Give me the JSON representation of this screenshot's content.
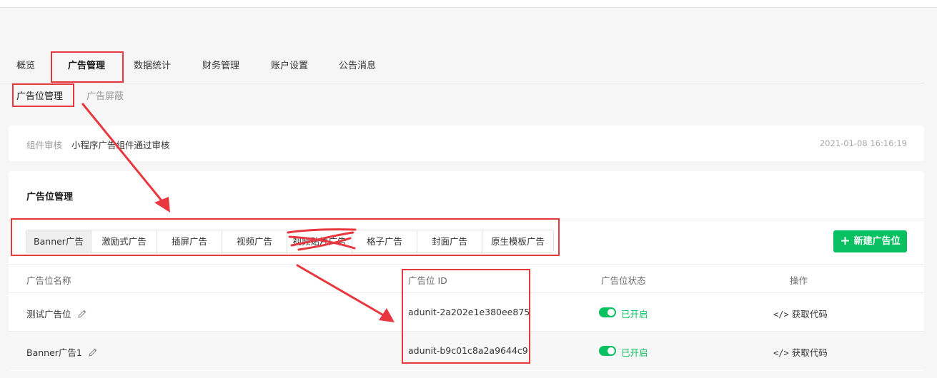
{
  "nav": {
    "tabs": [
      {
        "label": "概览"
      },
      {
        "label": "广告管理"
      },
      {
        "label": "数据统计"
      },
      {
        "label": "财务管理"
      },
      {
        "label": "账户设置"
      },
      {
        "label": "公告消息"
      }
    ]
  },
  "subnav": {
    "tabs": [
      {
        "label": "广告位管理"
      },
      {
        "label": "广告屏蔽"
      }
    ]
  },
  "review": {
    "label": "组件审核",
    "text": "小程序广告组件通过审核",
    "time": "2021-01-08 16:16:19"
  },
  "adunits": {
    "title": "广告位管理",
    "types": [
      {
        "label": "Banner广告"
      },
      {
        "label": "激励式广告"
      },
      {
        "label": "插屏广告"
      },
      {
        "label": "视频广告"
      },
      {
        "label": "视频贴片广告"
      },
      {
        "label": "格子广告"
      },
      {
        "label": "封面广告"
      },
      {
        "label": "原生模板广告"
      }
    ],
    "new_button": "新建广告位",
    "columns": [
      "广告位名称",
      "广告位 ID",
      "广告位状态",
      "操作"
    ],
    "rows": [
      {
        "name": "测试广告位",
        "id": "adunit-2a202e1e380ee875",
        "status": "已开启",
        "action": "获取代码"
      },
      {
        "name": "Banner广告1",
        "id": "adunit-b9c01c8a2a9644c9",
        "status": "已开启",
        "action": "获取代码"
      }
    ]
  },
  "colors": {
    "accent": "#07c160",
    "annotation": "#e8373f"
  },
  "icons": [
    "edit-pencil-icon",
    "code-icon",
    "plus-icon"
  ]
}
